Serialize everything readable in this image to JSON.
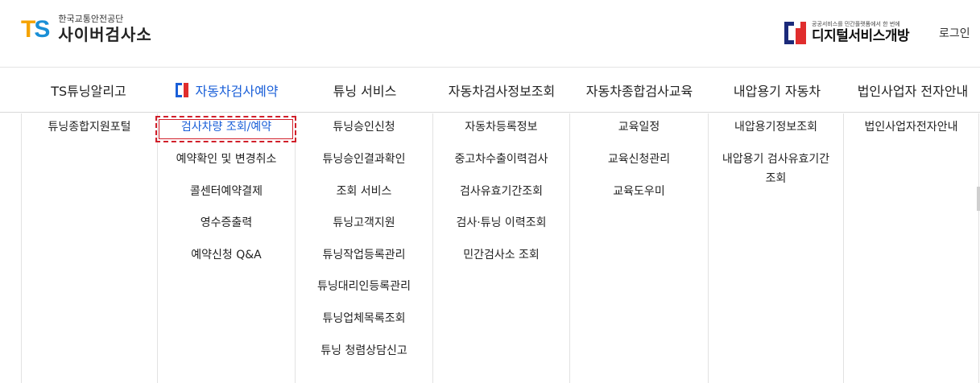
{
  "header": {
    "logo_mark_t": "T",
    "logo_mark_s": "S",
    "logo_org": "한국교통안전공단",
    "logo_title": "사이버검사소",
    "digital_sub": "공공서비스를 민간플랫폼에서 한 번에",
    "digital_title": "디지털서비스개방",
    "login": "로그인"
  },
  "nav": [
    {
      "label": "TS튜닝알리고"
    },
    {
      "label": "자동차검사예약"
    },
    {
      "label": "튜닝 서비스"
    },
    {
      "label": "자동차검사정보조회"
    },
    {
      "label": "자동차종합검사교육"
    },
    {
      "label": "내압용기 자동차"
    },
    {
      "label": "법인사업자 전자안내"
    }
  ],
  "menus": [
    [
      "튜닝종합지원포털"
    ],
    [
      "검사차량 조회/예약",
      "예약확인 및 변경취소",
      "콜센터예약결제",
      "영수증출력",
      "예약신청 Q&A"
    ],
    [
      "튜닝승인신청",
      "튜닝승인결과확인",
      "조회 서비스",
      "튜닝고객지원",
      "튜닝작업등록관리",
      "튜닝대리인등록관리",
      "튜닝업체목록조회",
      "튜닝 청렴상담신고"
    ],
    [
      "자동차등록정보",
      "중고차수출이력검사",
      "검사유효기간조회",
      "검사·튜닝 이력조회",
      "민간검사소 조회"
    ],
    [
      "교육일정",
      "교육신청관리",
      "교육도우미"
    ],
    [
      "내압용기정보조회",
      "내압용기 검사유효기간",
      "조회"
    ],
    [
      "법인사업자전자안내"
    ]
  ],
  "icons": {
    "active_nav_icon": "brand-bracket-icon",
    "digital_logo_icon": "digital-service-logo-icon"
  },
  "colors": {
    "accent": "#1a5fd8",
    "highlight_border": "#d11f2a",
    "ts_orange": "#f5a300",
    "ts_blue": "#1a8fd6"
  }
}
